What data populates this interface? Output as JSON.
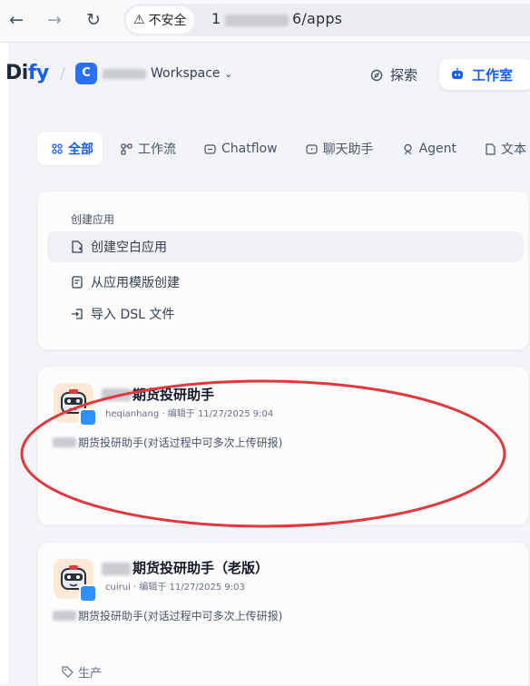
{
  "browser": {
    "security_label": "不安全",
    "url_prefix": "1",
    "url_suffix": "6/apps"
  },
  "header": {
    "logo_text_a": "Di",
    "logo_text_b": "fy",
    "workspace_initial": "C",
    "workspace_label": "Workspace",
    "explore_label": "探索",
    "studio_label": "工作室"
  },
  "tabs": [
    {
      "label": "全部",
      "icon": "grid-icon"
    },
    {
      "label": "工作流",
      "icon": "workflow-icon"
    },
    {
      "label": "Chatflow",
      "icon": "chatflow-icon"
    },
    {
      "label": "聊天助手",
      "icon": "chat-icon"
    },
    {
      "label": "Agent",
      "icon": "agent-icon"
    },
    {
      "label": "文本",
      "icon": "doc-icon"
    }
  ],
  "create": {
    "title": "创建应用",
    "items": [
      {
        "label": "创建空白应用",
        "icon": "file-plus-icon"
      },
      {
        "label": "从应用模版创建",
        "icon": "template-icon"
      },
      {
        "label": "导入 DSL 文件",
        "icon": "import-icon"
      }
    ]
  },
  "apps": [
    {
      "name": "期货投研助手",
      "meta": "heqianhang · 编辑于 11/27/2025 9:04",
      "desc": "期货投研助手(对话过程中可多次上传研报)"
    },
    {
      "name": "期货投研助手（老版）",
      "meta": "cuirui · 编辑于 11/27/2025 9:03",
      "desc": "期货投研助手(对话过程中可多次上传研报)",
      "tag": "生产"
    }
  ],
  "colors": {
    "accent": "#155eef",
    "annotation": "#e0383f",
    "background": "#f2f4f7"
  }
}
